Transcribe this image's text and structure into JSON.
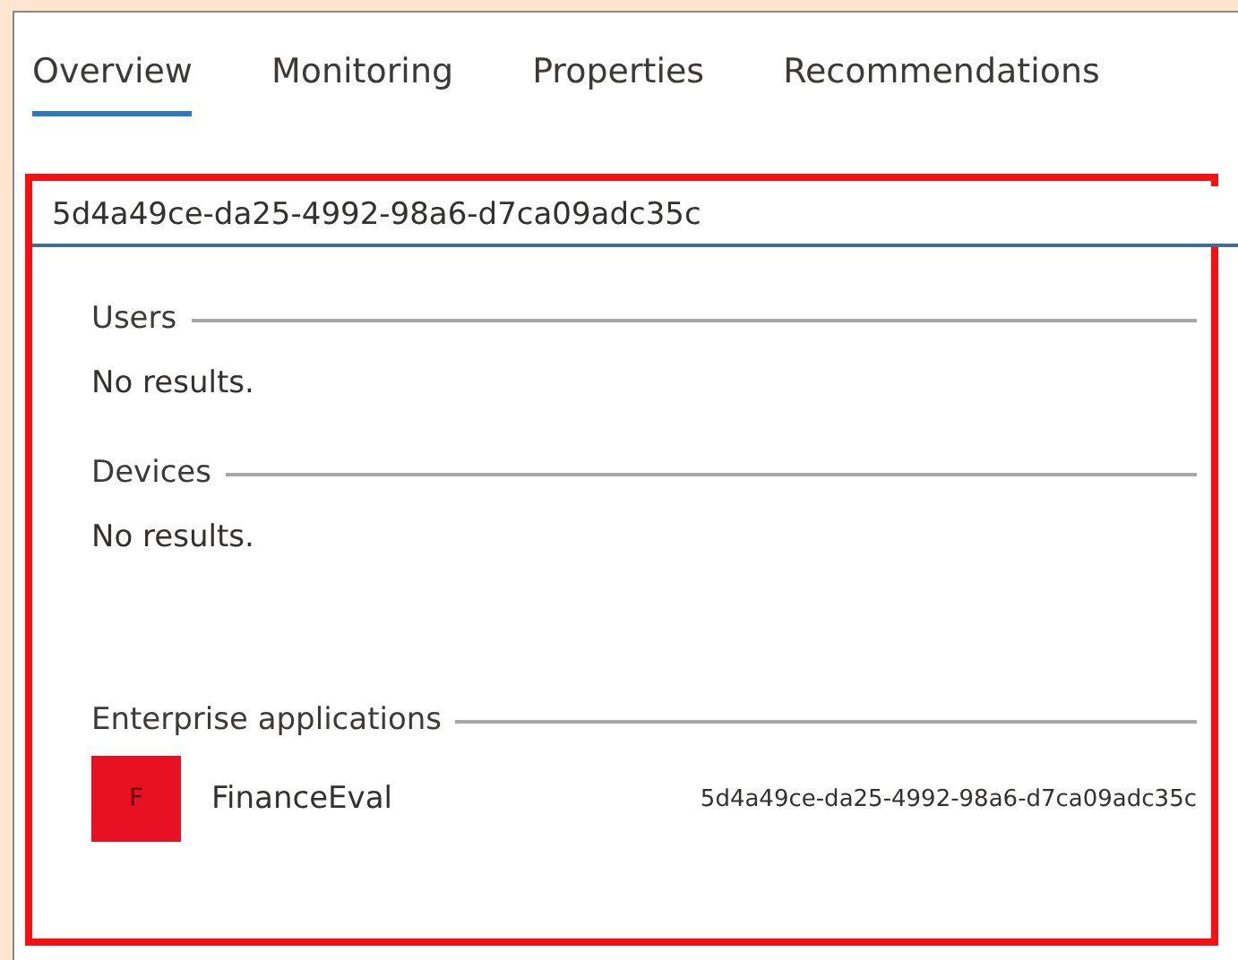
{
  "tabs": [
    {
      "label": "Overview",
      "selected": true
    },
    {
      "label": "Monitoring",
      "selected": false
    },
    {
      "label": "Properties",
      "selected": false
    },
    {
      "label": "Recommendations",
      "selected": false
    }
  ],
  "search": {
    "value": "5d4a49ce-da25-4992-98a6-d7ca09adc35c"
  },
  "sections": [
    {
      "title": "Users",
      "empty_text": "No results."
    },
    {
      "title": "Devices",
      "empty_text": "No results."
    },
    {
      "title": "Enterprise applications",
      "items": [
        {
          "initial": "F",
          "color": "#e81123",
          "name": "FinanceEval",
          "id": "5d4a49ce-da25-4992-98a6-d7ca09adc35c"
        }
      ]
    }
  ]
}
